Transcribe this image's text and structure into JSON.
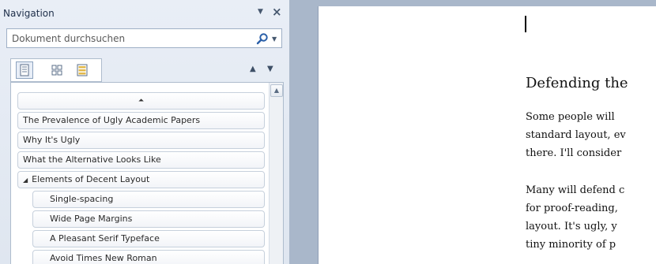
{
  "nav": {
    "title": "Navigation",
    "dropdown_glyph": "▼",
    "close_glyph": "×",
    "search": {
      "placeholder": "Dokument durchsuchen",
      "icon": "search-icon",
      "dropdown_glyph": "▼"
    },
    "view_tabs": [
      "headings-view-icon",
      "pages-view-icon",
      "results-view-icon"
    ],
    "up_glyph": "▲",
    "down_glyph": "▼",
    "collapse_glyph": "⏶",
    "headings": [
      {
        "label": "The Prevalence of Ugly Academic Papers",
        "level": 1
      },
      {
        "label": "Why It's Ugly",
        "level": 1
      },
      {
        "label": "What the Alternative Looks Like",
        "level": 1
      },
      {
        "label": "Elements of Decent Layout",
        "level": 1,
        "expanded": true
      },
      {
        "label": "Single-spacing",
        "level": 2
      },
      {
        "label": "Wide Page Margins",
        "level": 2
      },
      {
        "label": "A Pleasant Serif Typeface",
        "level": 2
      },
      {
        "label": "Avoid Times New Roman",
        "level": 2
      }
    ],
    "expand_glyph": "◢",
    "scroll_up_glyph": "▲"
  },
  "document": {
    "heading": "Defending the",
    "lines": [
      "Some people will",
      "standard layout, ev",
      "there. I'll consider",
      "Many will defend c",
      "for proof-reading,",
      "layout. It's ugly, y",
      "tiny minority of p"
    ]
  }
}
